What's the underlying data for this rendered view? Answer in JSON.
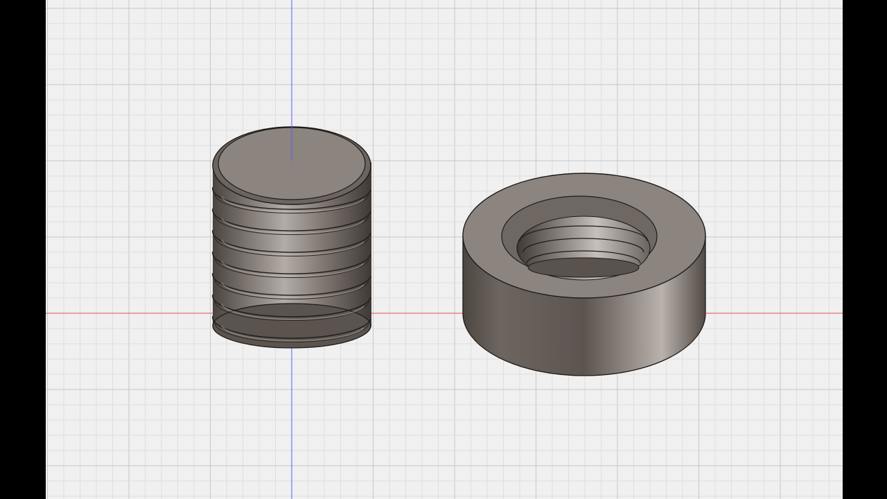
{
  "scene": {
    "background_color": "#f0f0f0",
    "letterbox_color": "#000000",
    "grid": {
      "minor_color": "#dedede",
      "major_color": "#c6c6c6"
    },
    "axes": {
      "x_axis_color": "#e05050",
      "z_axis_color": "#5a5af0"
    },
    "models": [
      {
        "name": "threaded-bolt",
        "thread_turns": 7,
        "body_color": "#7c746e"
      },
      {
        "name": "threaded-nut",
        "internal_thread_turns": 3,
        "body_color": "#7a716b"
      }
    ]
  }
}
